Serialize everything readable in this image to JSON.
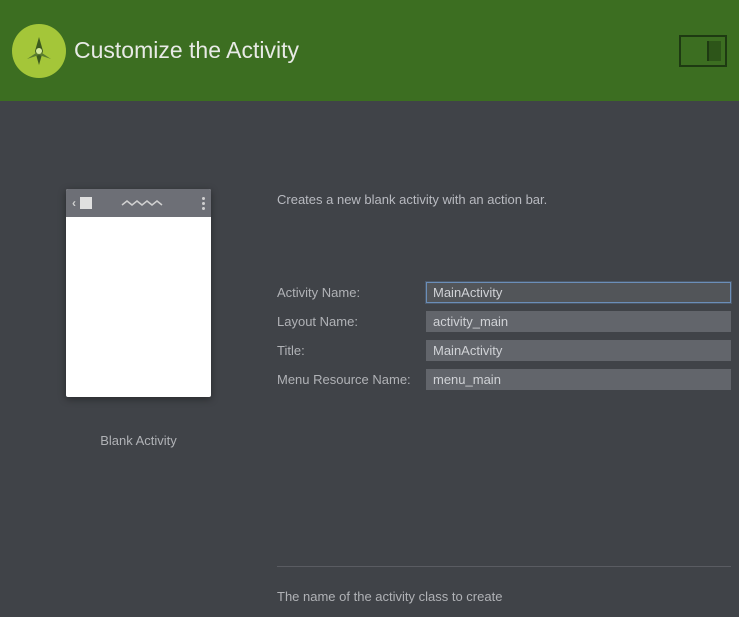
{
  "header": {
    "title": "Customize the Activity"
  },
  "description": "Creates a new blank activity with an action bar.",
  "preview": {
    "label": "Blank Activity"
  },
  "fields": [
    {
      "label": "Activity Name:",
      "value": "MainActivity",
      "focused": true
    },
    {
      "label": "Layout Name:",
      "value": "activity_main",
      "focused": false
    },
    {
      "label": "Title:",
      "value": "MainActivity",
      "focused": false
    },
    {
      "label": "Menu Resource Name:",
      "value": "menu_main",
      "focused": false
    }
  ],
  "hint": "The name of the activity class to create"
}
